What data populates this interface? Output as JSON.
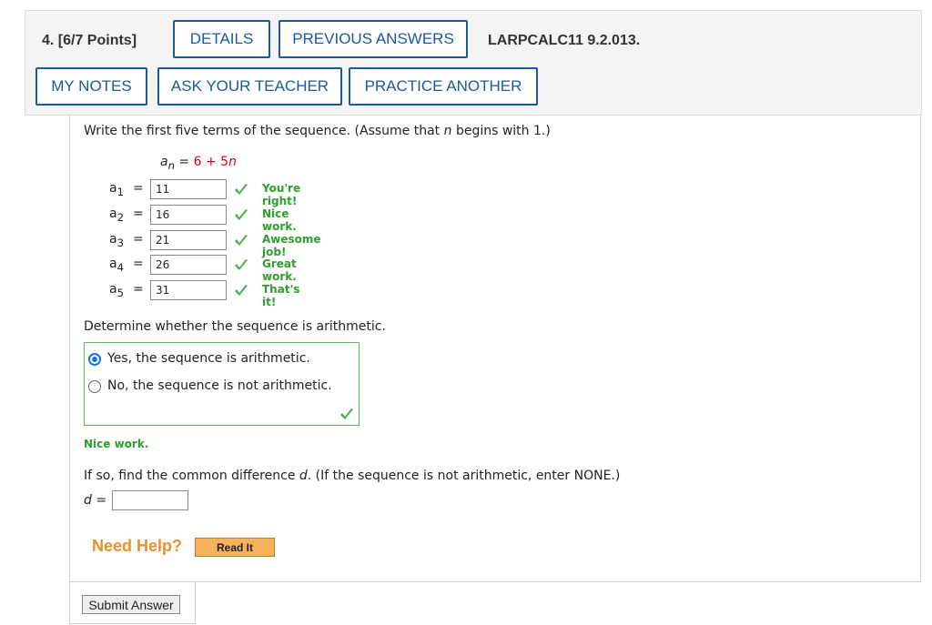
{
  "question": {
    "number_label": "4.  [6/7 Points]",
    "reference": "LARPCALC11 9.2.013."
  },
  "toolbar": {
    "details": "DETAILS",
    "previous_answers": "PREVIOUS ANSWERS",
    "my_notes": "MY NOTES",
    "ask_teacher": "ASK YOUR TEACHER",
    "practice_another": "PRACTICE ANOTHER"
  },
  "part1": {
    "instruction_prefix": "Write the first five terms of the sequence. (Assume that ",
    "instruction_var": "n",
    "instruction_suffix": " begins with 1.)",
    "formula": {
      "lhs": "a",
      "lhs_sub": "n",
      "eq": " = ",
      "rhs_const": "6 + 5",
      "rhs_var": "n"
    },
    "terms": [
      {
        "label": "a",
        "sub": "1",
        "eq": "=",
        "value": "11",
        "feedback": "You're right!"
      },
      {
        "label": "a",
        "sub": "2",
        "eq": "=",
        "value": "16",
        "feedback": "Nice work."
      },
      {
        "label": "a",
        "sub": "3",
        "eq": "=",
        "value": "21",
        "feedback": "Awesome job!"
      },
      {
        "label": "a",
        "sub": "4",
        "eq": "=",
        "value": "26",
        "feedback": "Great work."
      },
      {
        "label": "a",
        "sub": "5",
        "eq": "=",
        "value": "31",
        "feedback": "That's it!"
      }
    ]
  },
  "part2": {
    "prompt": "Determine whether the sequence is arithmetic.",
    "options": [
      {
        "label": "Yes, the sequence is arithmetic.",
        "selected": true
      },
      {
        "label": "No, the sequence is not arithmetic.",
        "selected": false
      }
    ],
    "feedback": "Nice work."
  },
  "part3": {
    "prompt_prefix": "If so, find the common difference ",
    "prompt_var": "d",
    "prompt_suffix": ". (If the sequence is not arithmetic, enter NONE.)",
    "var_label": "d",
    "eq": " =",
    "value": ""
  },
  "help": {
    "need_help": "Need Help?",
    "read_it": "Read It"
  },
  "submit_label": "Submit Answer",
  "colors": {
    "button_blue": "#1a5a9c",
    "correct_green": "#2e9e2e",
    "formula_red": "#d0021b",
    "help_orange": "#e8902a"
  }
}
